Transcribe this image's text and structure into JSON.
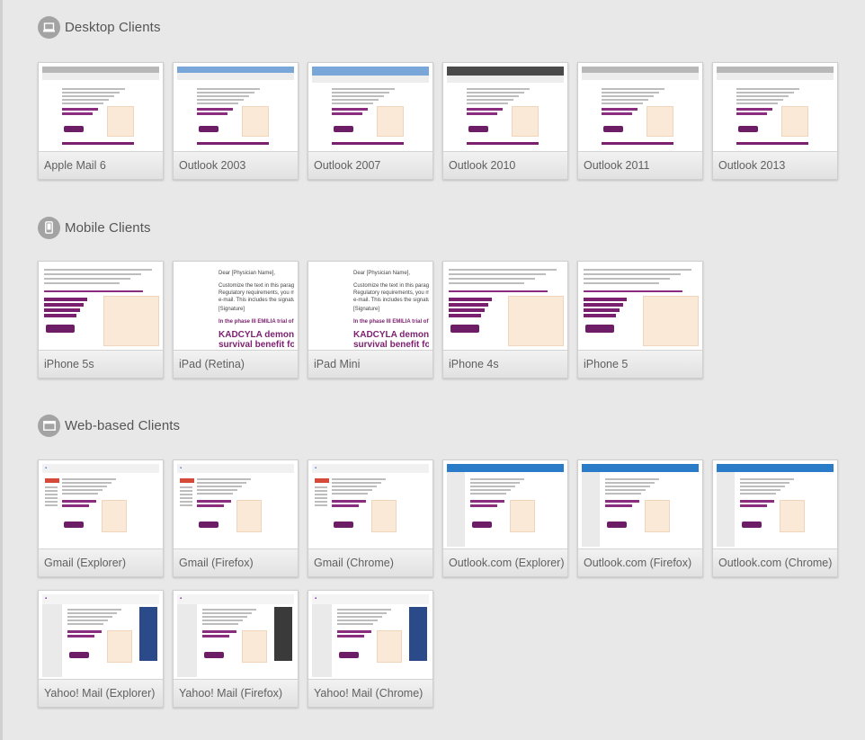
{
  "sections": {
    "desktop": {
      "title": "Desktop Clients",
      "icon": "laptop-icon",
      "clients": [
        "Apple Mail 6",
        "Outlook 2003",
        "Outlook 2007",
        "Outlook 2010",
        "Outlook 2011",
        "Outlook 2013"
      ]
    },
    "mobile": {
      "title": "Mobile Clients",
      "icon": "phone-icon",
      "clients": [
        "iPhone 5s",
        "iPad (Retina)",
        "iPad Mini",
        "iPhone 4s",
        "iPhone 5"
      ]
    },
    "web": {
      "title": "Web-based Clients",
      "icon": "browser-icon",
      "clients": [
        "Gmail (Explorer)",
        "Gmail (Firefox)",
        "Gmail (Chrome)",
        "Outlook.com (Explorer)",
        "Outlook.com (Firefox)",
        "Outlook.com (Chrome)",
        "Yahoo! Mail (Explorer)",
        "Yahoo! Mail (Firefox)",
        "Yahoo! Mail (Chrome)"
      ]
    }
  },
  "thumb_text": {
    "greeting": "Dear [Physician Name],",
    "body1": "Customize the text in this paragraph with",
    "body2": "Regulatory requirements, you may only in",
    "body3": "e-mail. This includes the signature.",
    "signature": "[Signature]",
    "phase": "In the phase III EMILIA trial of KA",
    "headline1": "KADCYLA demonstr",
    "headline2": "survival benefit for",
    "brand": "Kadcyla"
  },
  "colors": {
    "background": "#e8e8e8",
    "icon_circle": "#a3a3a3",
    "brand_purple": "#7b1f6f",
    "label_text": "#606060"
  }
}
